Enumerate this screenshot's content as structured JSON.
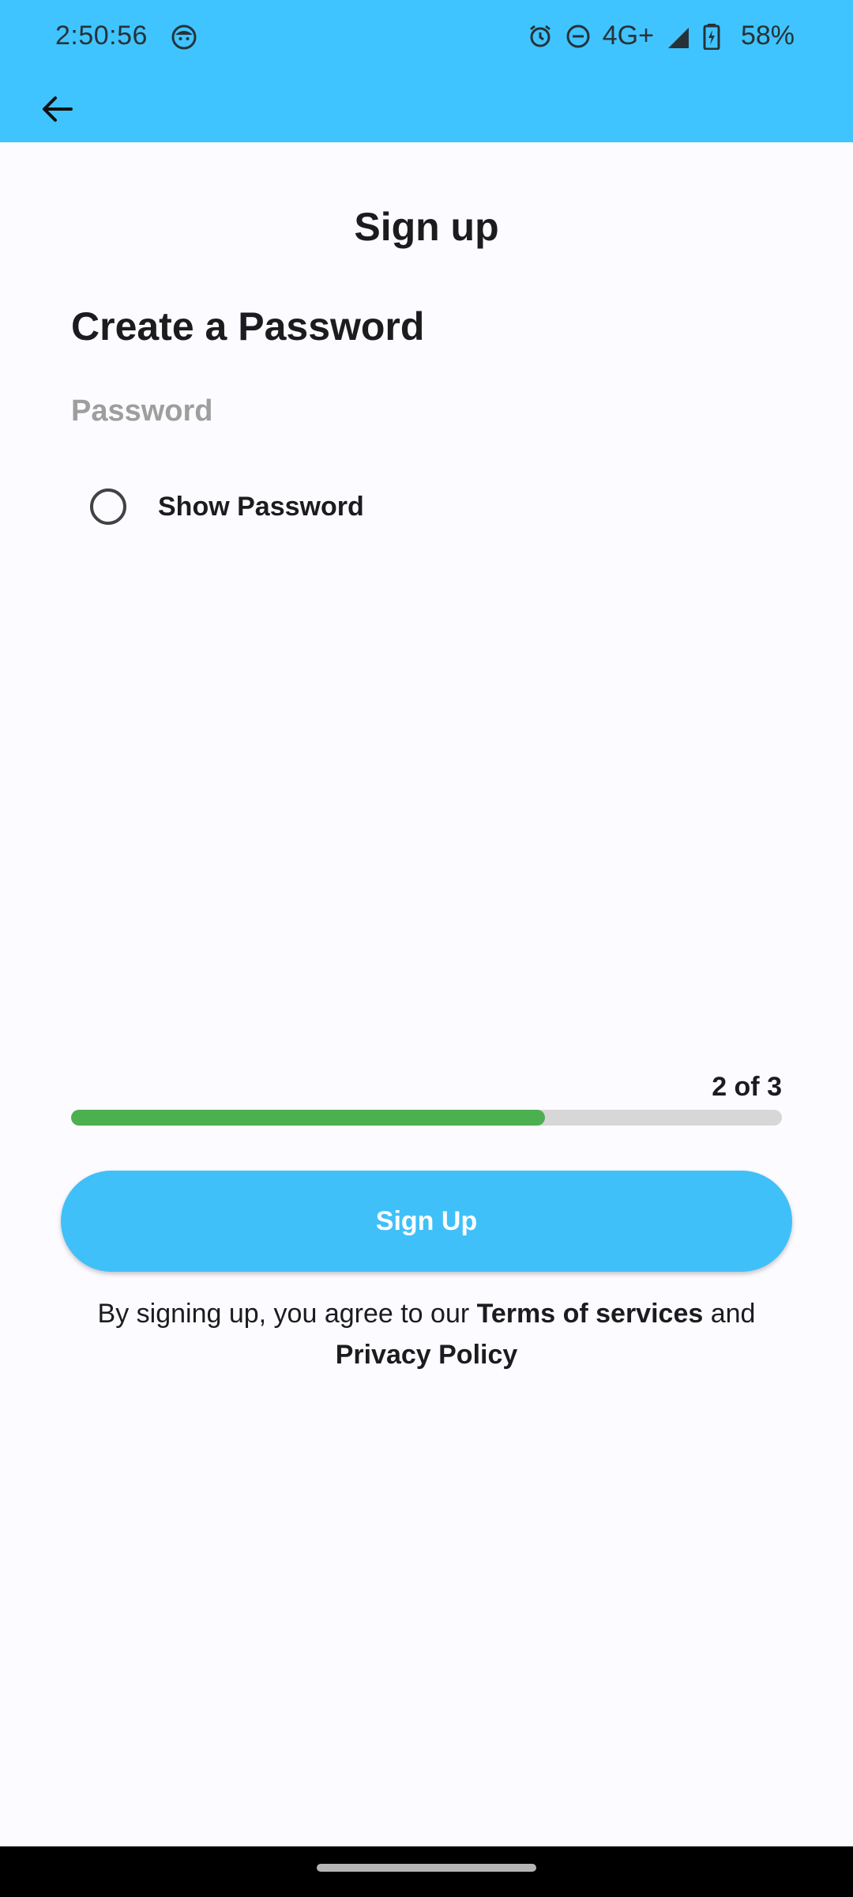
{
  "status_bar": {
    "time": "2:50:56",
    "network": "4G+",
    "battery": "58%"
  },
  "app_bar": {
    "back_icon": "arrow-left-icon"
  },
  "page": {
    "title": "Sign up",
    "heading": "Create a Password",
    "password_placeholder": "Password",
    "password_value": "",
    "show_password_label": "Show Password",
    "show_password_checked": false
  },
  "progress": {
    "label": "2 of 3",
    "fraction": 0.667,
    "fill_color": "#4caf50",
    "track_color": "#d7d7d7"
  },
  "signup_button": {
    "label": "Sign Up",
    "color": "#40c0f8"
  },
  "terms": {
    "prefix": "By signing up, you agree to our",
    "terms_link": "Terms of services",
    "conjunction": "and",
    "privacy_link": "Privacy Policy"
  },
  "colors": {
    "accent": "#40c4ff",
    "background": "#fcfbff"
  },
  "icons": {
    "status": [
      "face-icon",
      "alarm-icon",
      "do-not-disturb-icon",
      "signal-icon",
      "battery-charging-icon"
    ]
  }
}
